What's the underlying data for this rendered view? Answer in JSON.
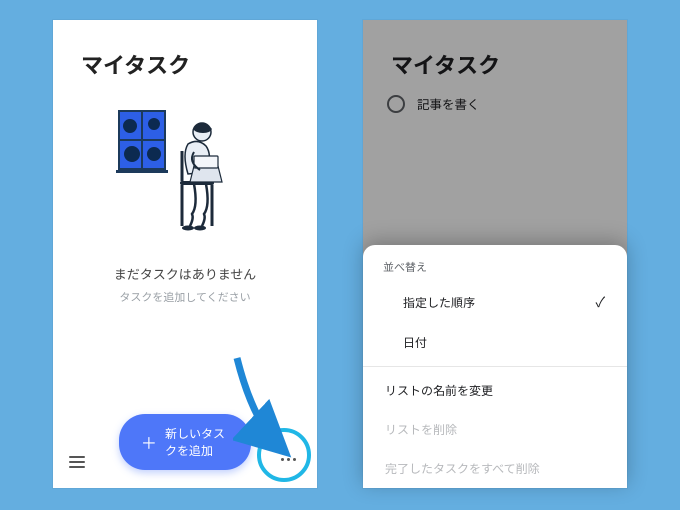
{
  "left": {
    "title": "マイタスク",
    "empty_head": "まだタスクはありません",
    "empty_sub": "タスクを追加してください",
    "fab_label": "新しいタスクを追加"
  },
  "right": {
    "title": "マイタスク",
    "task_label": "記事を書く",
    "sheet": {
      "section_label": "並べ替え",
      "opt_order": "指定した順序",
      "opt_date": "日付",
      "rename": "リストの名前を変更",
      "delete_list": "リストを削除",
      "delete_done": "完了したタスクをすべて削除"
    }
  }
}
